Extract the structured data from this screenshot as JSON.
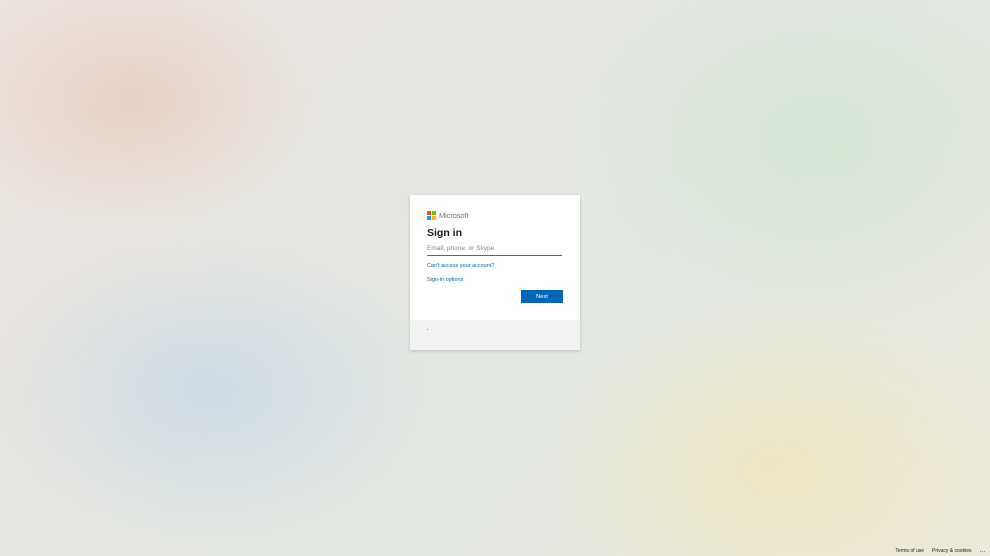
{
  "brand": {
    "name": "Microsoft",
    "logo_colors": [
      "#f25022",
      "#7fba00",
      "#00a4ef",
      "#ffb900"
    ],
    "icon": "microsoft-logo"
  },
  "signin": {
    "title": "Sign in",
    "email_placeholder": "Email, phone, or Skype",
    "email_value": "",
    "cant_access_link": "Can't access your account?",
    "signin_options_link": "Sign-in options",
    "next_button": "Next"
  },
  "footer": {
    "terms": "Terms of use",
    "privacy": "Privacy & cookies",
    "more": "..."
  },
  "colors": {
    "accent": "#0067b8",
    "card_background": "#ffffff",
    "card_footer_background": "#f2f2f2"
  }
}
